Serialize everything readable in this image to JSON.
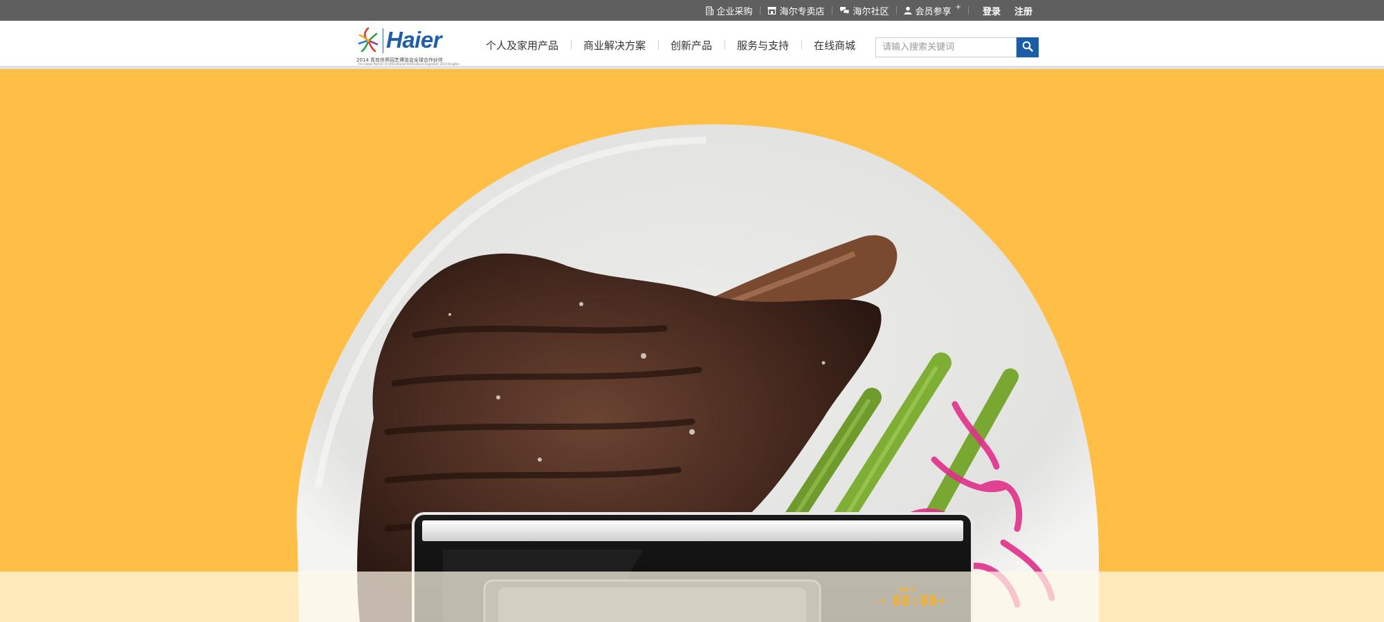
{
  "topbar": {
    "links": [
      {
        "label": "企业采购",
        "icon": "building-icon"
      },
      {
        "label": "海尔专卖店",
        "icon": "store-icon"
      },
      {
        "label": "海尔社区",
        "icon": "chat-icon"
      },
      {
        "label": "会员参享",
        "icon": "user-icon",
        "superscript": "+"
      }
    ],
    "login": "登录",
    "register": "注册"
  },
  "header": {
    "logo": {
      "word": "Haier",
      "caption": "2014 青岛世界园艺博览会全球合作伙伴",
      "caption_small": "The Global Partner of International Horticultural Exposition 2014 Qingdao"
    },
    "nav": [
      "个人及家用产品",
      "商业解决方案",
      "创新产品",
      "服务与支持",
      "在线商城"
    ],
    "search": {
      "placeholder": "请输入搜索关键词",
      "button_icon": "search-icon"
    }
  },
  "hero": {
    "image": "steak-plate-with-asparagus-and-microwave-oven",
    "oven_display": {
      "time": "88:88",
      "minus": "−",
      "plus": "+"
    }
  },
  "colors": {
    "topbar": "#5f5f5f",
    "hero_background": "#ffbf47",
    "brand_blue": "#1a5ca8"
  }
}
